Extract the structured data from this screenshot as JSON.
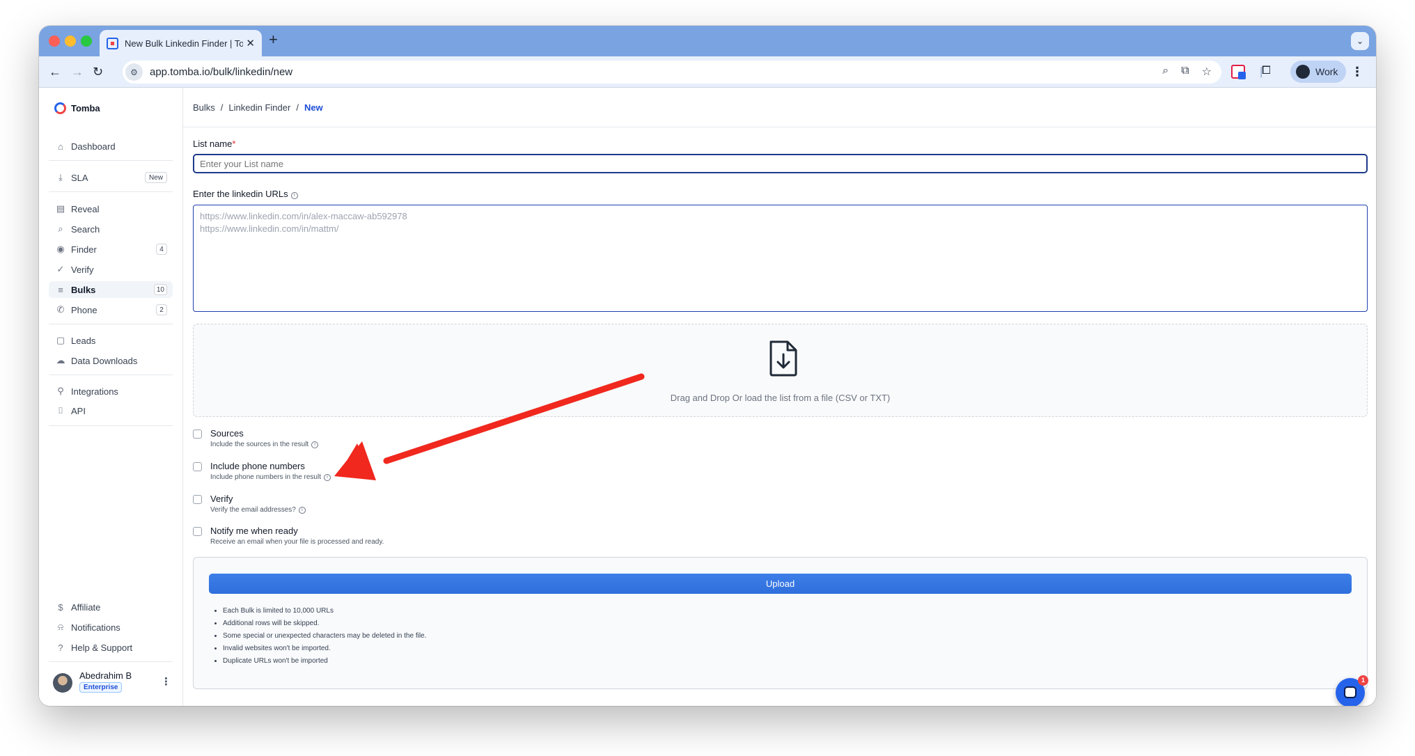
{
  "browser": {
    "tab_title": "New Bulk Linkedin Finder | To",
    "tab_close": "✕",
    "new_tab": "+",
    "url": "app.tomba.io/bulk/linkedin/new",
    "profile_label": "Work"
  },
  "sidebar": {
    "logo": "Tomba",
    "items": [
      {
        "label": "Dashboard",
        "icon": "home-icon"
      },
      {
        "label": "SLA",
        "icon": "download-icon",
        "badge": "New"
      },
      {
        "label": "Reveal",
        "icon": "document-icon"
      },
      {
        "label": "Search",
        "icon": "search-icon"
      },
      {
        "label": "Finder",
        "icon": "user-circle-icon",
        "badge": "4"
      },
      {
        "label": "Verify",
        "icon": "check-circle-icon"
      },
      {
        "label": "Bulks",
        "icon": "stack-icon",
        "badge": "10"
      },
      {
        "label": "Phone",
        "icon": "phone-icon",
        "badge": "2"
      },
      {
        "label": "Leads",
        "icon": "file-plus-icon"
      },
      {
        "label": "Data Downloads",
        "icon": "cloud-icon"
      },
      {
        "label": "Integrations",
        "icon": "plug-icon"
      },
      {
        "label": "API",
        "icon": "code-icon"
      },
      {
        "label": "Affiliate",
        "icon": "dollar-icon"
      },
      {
        "label": "Notifications",
        "icon": "bell-icon"
      },
      {
        "label": "Help & Support",
        "icon": "help-icon"
      }
    ],
    "user": {
      "name": "Abedrahim B",
      "plan": "Enterprise"
    }
  },
  "breadcrumb": {
    "items": [
      "Bulks",
      "/",
      "Linkedin Finder",
      "/"
    ],
    "current": "New"
  },
  "form": {
    "list_name_label": "List name",
    "required_mark": "*",
    "list_name_placeholder": "Enter your List name",
    "urls_label": "Enter the linkedin URLs",
    "urls_placeholder_1": "https://www.linkedin.com/in/alex-maccaw-ab592978",
    "urls_placeholder_2": "https://www.linkedin.com/in/mattm/",
    "dropzone_text": "Drag and Drop Or load the list from a file (CSV or TXT)",
    "options": [
      {
        "title": "Sources",
        "desc": "Include the sources in the result",
        "info": true,
        "checked": false
      },
      {
        "title": "Include phone numbers",
        "desc": "Include phone numbers in the result",
        "info": true,
        "checked": false
      },
      {
        "title": "Verify",
        "desc": "Verify the email addresses?",
        "info": true,
        "checked": false
      },
      {
        "title": "Notify me when ready",
        "desc": "Receive an email when your file is processed and ready.",
        "info": false,
        "checked": false
      }
    ],
    "upload_label": "Upload",
    "notes": [
      "Each Bulk is limited to 10,000 URLs",
      "Additional rows will be skipped.",
      "Some special or unexpected characters may be deleted in the file.",
      "Invalid websites won't be imported.",
      "Duplicate URLs won't be imported"
    ]
  },
  "chat": {
    "unread": "1"
  },
  "colors": {
    "accent": "#2563eb",
    "annotation_arrow": "#f0281e",
    "chrome": "#7aa3e1"
  }
}
